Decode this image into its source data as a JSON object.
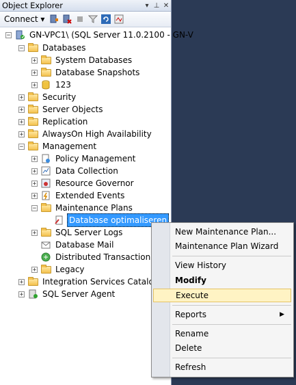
{
  "window": {
    "title": "Object Explorer",
    "pin": "▾ ⊥ ✕"
  },
  "toolbar": {
    "connect_label": "Connect ▾"
  },
  "tree": {
    "server": "GN-VPC1\\ (SQL Server 11.0.2100 - GN-V",
    "databases": "Databases",
    "system_databases": "System Databases",
    "database_snapshots": "Database Snapshots",
    "db_123": "123",
    "security": "Security",
    "server_objects": "Server Objects",
    "replication": "Replication",
    "alwayson": "AlwaysOn High Availability",
    "management": "Management",
    "policy_management": "Policy Management",
    "data_collection": "Data Collection",
    "resource_governor": "Resource Governor",
    "extended_events": "Extended Events",
    "maintenance_plans": "Maintenance Plans",
    "plan_selected": "Database optimaliseren",
    "sql_server_logs": "SQL Server Logs",
    "database_mail": "Database Mail",
    "dtc": "Distributed Transaction Co",
    "legacy": "Legacy",
    "integration_catalogs": "Integration Services Catalogs",
    "sql_agent": "SQL Server Agent"
  },
  "context_menu": {
    "new_plan": "New Maintenance Plan...",
    "wizard": "Maintenance Plan Wizard",
    "view_history": "View History",
    "modify": "Modify",
    "execute": "Execute",
    "reports": "Reports",
    "rename": "Rename",
    "delete": "Delete",
    "refresh": "Refresh"
  },
  "colors": {
    "selection": "#3399ff",
    "highlight": "#fff3c4",
    "background": "#2b3a55"
  }
}
